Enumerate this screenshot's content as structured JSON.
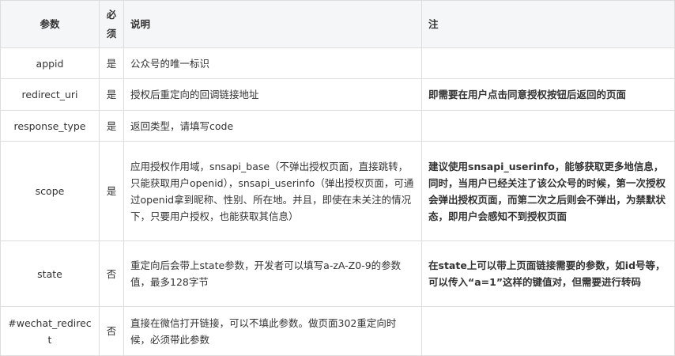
{
  "header": {
    "param": "参数",
    "required": "必须",
    "description": "说明",
    "note": "注"
  },
  "rows": [
    {
      "param": "appid",
      "required": "是",
      "description": "公众号的唯一标识",
      "note": ""
    },
    {
      "param": "redirect_uri",
      "required": "是",
      "description": "授权后重定向的回调链接地址",
      "note": "即需要在用户点击同意授权按钮后返回的页面"
    },
    {
      "param": "response_type",
      "required": "是",
      "description": "返回类型，请填写code",
      "note": ""
    },
    {
      "param": "scope",
      "required": "是",
      "description": "应用授权作用域，snsapi_base（不弹出授权页面，直接跳转，只能获取用户openid），snsapi_userinfo（弹出授权页面，可通过openid拿到昵称、性别、所在地。并且，即使在未关注的情况下，只要用户授权，也能获取其信息）",
      "note": "建议使用snsapi_userinfo，能够获取更多地信息，同时，当用户已经关注了该公众号的时候，第一次授权会弹出授权页面，而第二次之后则会不弹出，为禁默状态，即用户会感知不到授权页面"
    },
    {
      "param": "state",
      "required": "否",
      "description": "重定向后会带上state参数，开发者可以填写a-zA-Z0-9的参数值，最多128字节",
      "note": "在state上可以带上页面链接需要的参数，如id号等，可以传入“a=1”这样的键值对，但需要进行转码"
    },
    {
      "param": "#wechat_redirect",
      "required": "否",
      "description": "直接在微信打开链接，可以不填此参数。做页面302重定向时候，必须带此参数",
      "note": ""
    }
  ]
}
